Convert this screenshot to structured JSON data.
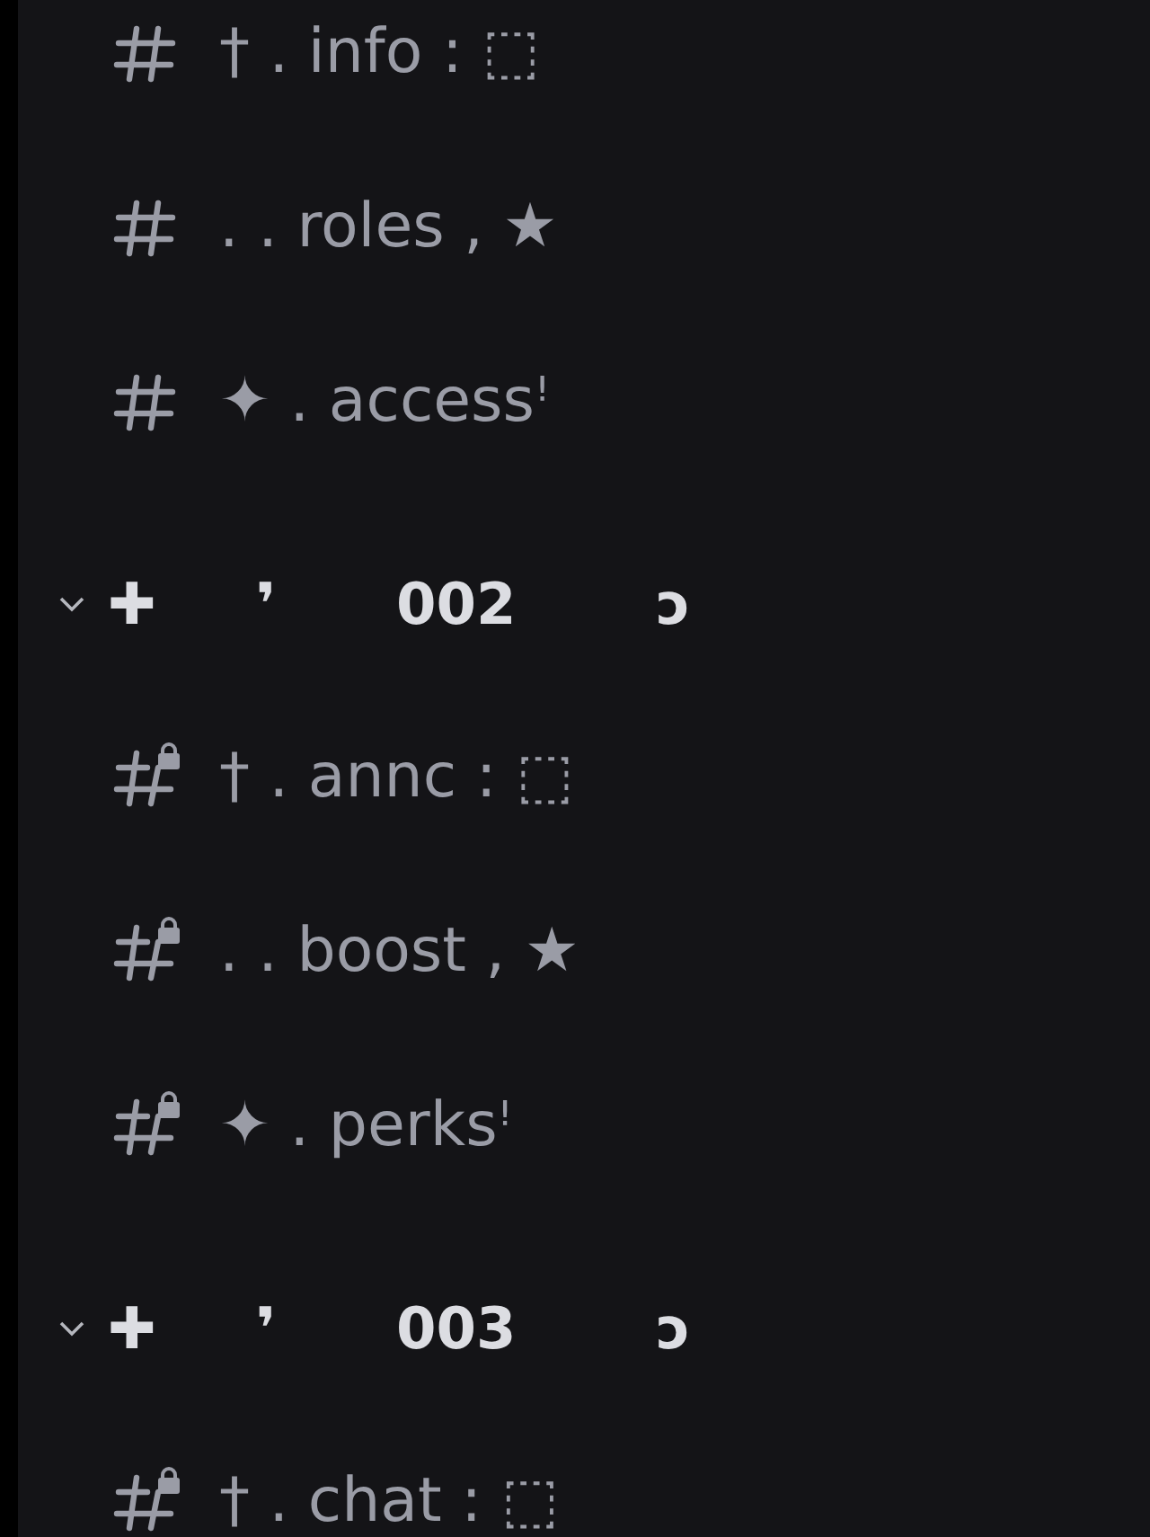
{
  "channels": [
    {
      "name": "† . info : ⬚",
      "locked": false
    },
    {
      "name": ". . roles , ★",
      "locked": false
    },
    {
      "name": "✦ . accessꜝ",
      "locked": false
    }
  ],
  "categories": [
    {
      "name": "✚     ❜      002       ɔ",
      "expanded": true,
      "channels": [
        {
          "name": "† . annc : ⬚",
          "locked": true
        },
        {
          "name": ". . boost , ★",
          "locked": true
        },
        {
          "name": "✦ . perksꜝ",
          "locked": true
        }
      ]
    },
    {
      "name": "✚     ❜      003       ɔ",
      "expanded": true,
      "channels": [
        {
          "name": "† . chat : ⬚",
          "locked": true
        }
      ]
    }
  ]
}
